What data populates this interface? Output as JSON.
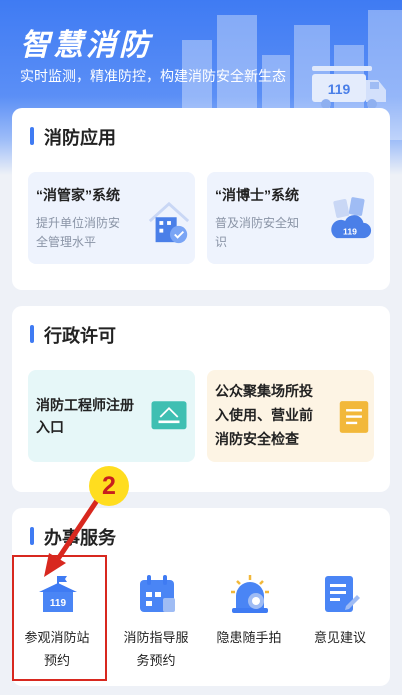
{
  "header": {
    "title": "智慧消防",
    "subtitle": "实时监测，精准防控，构建消防安全新生态",
    "truck_number": "119"
  },
  "apps_section": {
    "title": "消防应用",
    "tiles": [
      {
        "title": "“消管家”系统",
        "desc_line1": "提升单位消防安",
        "desc_line2": "全管理水平",
        "icon": "building-shield-icon"
      },
      {
        "title": "“消博士”系统",
        "desc_line1": "普及消防安全知",
        "desc_line2": "识",
        "icon": "cloud-119-icon",
        "icon_text": "119"
      }
    ]
  },
  "permit_section": {
    "title": "行政许可",
    "tiles": [
      {
        "line1": "消防工程师注册",
        "line2": "入口",
        "icon": "certificate-icon"
      },
      {
        "line1": "公众聚集场所投",
        "line2": "入使用、营业前",
        "line3": "消防安全检查",
        "icon": "document-check-icon"
      }
    ]
  },
  "services_section": {
    "title": "办事服务",
    "items": [
      {
        "line1": "参观消防站",
        "line2": "预约",
        "icon": "fire-station-icon",
        "icon_text": "119"
      },
      {
        "line1": "消防指导服",
        "line2": "务预约",
        "icon": "calendar-icon"
      },
      {
        "line1": "隐患随手拍",
        "line2": "",
        "icon": "alarm-camera-icon"
      },
      {
        "line1": "意见建议",
        "line2": "",
        "icon": "edit-note-icon"
      }
    ]
  },
  "annotation": {
    "step_number": "2",
    "colors": {
      "box": "#d8281f",
      "badge": "#ffdd1f"
    }
  },
  "colors": {
    "accent": "#3f7bf3",
    "background": "#eef1f7",
    "apps_tile_bg": "#eef3fd",
    "permit_tile1_bg": "#e6f7f8",
    "permit_tile2_bg": "#fdf4e4"
  }
}
